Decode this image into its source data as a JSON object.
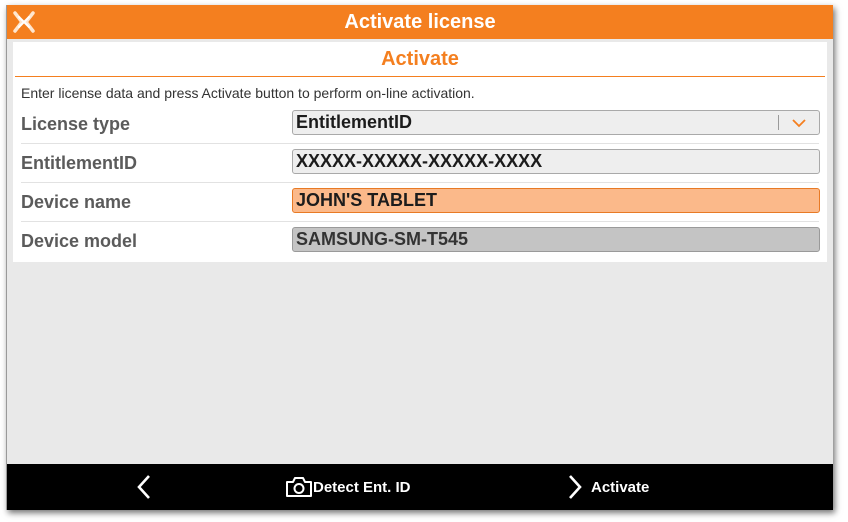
{
  "window": {
    "title": "Activate license"
  },
  "panel": {
    "section_title": "Activate",
    "instructions": "Enter license data and press Activate button to perform on-line activation."
  },
  "form": {
    "license_type": {
      "label": "License type",
      "value": "EntitlementID"
    },
    "entitlement_id": {
      "label": "EntitlementID",
      "value": "XXXXX-XXXXX-XXXXX-XXXX"
    },
    "device_name": {
      "label": "Device name",
      "value": "JOHN'S TABLET"
    },
    "device_model": {
      "label": "Device model",
      "value": "SAMSUNG-SM-T545"
    }
  },
  "bottom_bar": {
    "back_icon": "chevron-left-icon",
    "detect_label": "Detect Ent. ID",
    "detect_icon": "camera-icon",
    "activate_label": "Activate",
    "activate_icon": "chevron-right-icon"
  },
  "colors": {
    "accent": "#f47f1f",
    "focused_field": "#fbb98a",
    "readonly_field": "#c4c4c4",
    "bottom_bar": "#000000"
  }
}
